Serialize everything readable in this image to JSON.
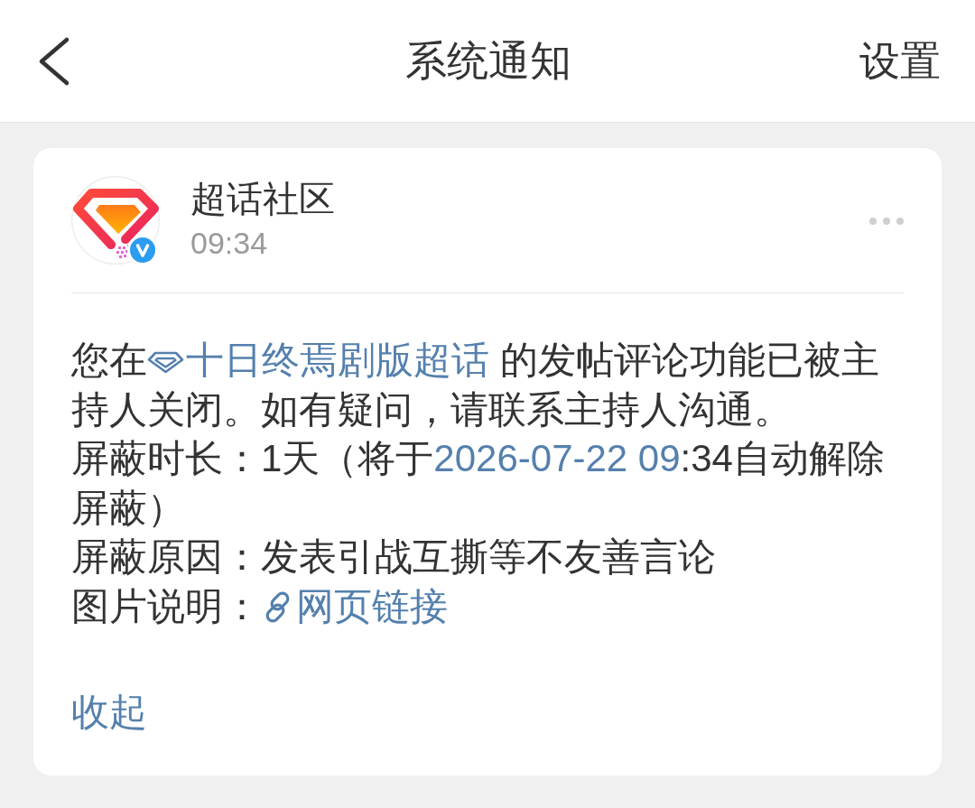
{
  "header": {
    "title": "系统通知",
    "action": "设置"
  },
  "card": {
    "sender": {
      "name": "超话社区",
      "time": "09:34",
      "verified": true
    },
    "paragraphs": [
      {
        "parts": [
          {
            "kind": "text",
            "text": "您在"
          },
          {
            "kind": "topic",
            "text": "十日终焉剧版超话"
          },
          {
            "kind": "text",
            "text": " 的发帖评论功能已被主持人关闭。如有疑问，请联系主持人沟通。"
          }
        ]
      },
      {
        "parts": [
          {
            "kind": "text",
            "text": "屏蔽时长：1天（将于"
          },
          {
            "kind": "link",
            "text": "2026-07-22 09"
          },
          {
            "kind": "text",
            "text": ":34自动解除屏蔽）"
          }
        ]
      },
      {
        "parts": [
          {
            "kind": "text",
            "text": "屏蔽原因：发表引战互撕等不友善言论"
          }
        ]
      },
      {
        "parts": [
          {
            "kind": "text",
            "text": "图片说明："
          },
          {
            "kind": "web",
            "text": "网页链接"
          }
        ]
      }
    ],
    "collapse": "收起"
  }
}
